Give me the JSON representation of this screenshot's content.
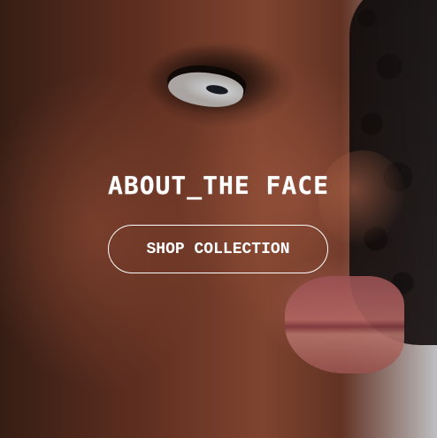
{
  "hero": {
    "title": "ABOUT_THE FACE",
    "cta_label": "SHOP COLLECTION",
    "text_color": "#ffffff",
    "image": "close-up profile portrait photo"
  }
}
